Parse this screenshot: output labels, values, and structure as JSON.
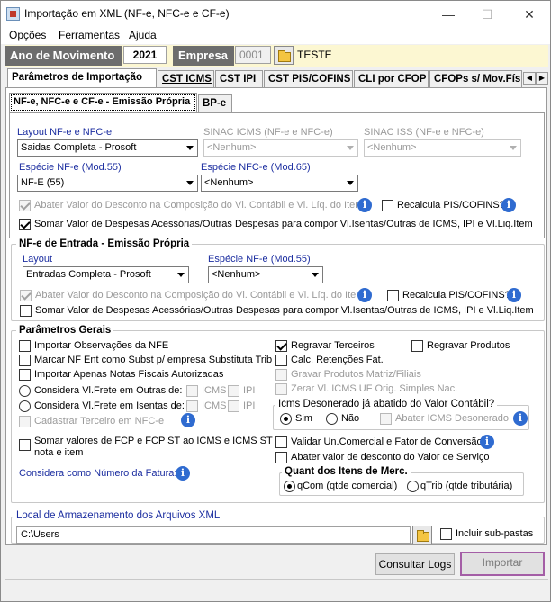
{
  "window": {
    "title": "Importação em XML (NF-e, NFC-e e CF-e)",
    "controls": {
      "minimize": "—",
      "maximize": "☐",
      "close": "✕"
    }
  },
  "menu": [
    "Opções",
    "Ferramentas",
    "Ajuda"
  ],
  "header": {
    "ano_label": "Ano de Movimento",
    "ano_value": "2021",
    "empresa_label": "Empresa",
    "empresa_code": "0001",
    "empresa_name": "TESTE"
  },
  "tabs": [
    "Parâmetros de Importação",
    "CST ICMS",
    "CST IPI",
    "CST PIS/COFINS",
    "CLI por CFOP",
    "CFOPs s/ Mov.Fís"
  ],
  "subtabs": [
    "NF-e, NFC-e e CF-e - Emissão Própria",
    "BP-e"
  ],
  "emissao": {
    "layout_label": "Layout NF-e e NFC-e",
    "layout_value": "Saidas Completa - Prosoft",
    "sinac_icms_label": "SINAC ICMS (NF-e e NFC-e)",
    "sinac_icms_value": "<Nenhum>",
    "sinac_iss_label": "SINAC ISS (NF-e e NFC-e)",
    "sinac_iss_value": "<Nenhum>",
    "especie_nfe_label": "Espécie NF-e (Mod.55)",
    "especie_nfe_value": "NF-E (55)",
    "especie_nfce_label": "Espécie NFC-e (Mod.65)",
    "especie_nfce_value": "<Nenhum>",
    "abater_desconto": "Abater Valor do Desconto na Composição do Vl. Contábil e Vl. Líq. do Item",
    "recalcula": "Recalcula PIS/COFINS?",
    "somar_despesas": "Somar Valor de Despesas Acessórias/Outras Despesas para compor Vl.Isentas/Outras de ICMS, IPI e Vl.Liq.Item"
  },
  "entrada": {
    "title": "NF-e de Entrada - Emissão Própria",
    "layout_label": "Layout",
    "layout_value": "Entradas Completa - Prosoft",
    "especie_label": "Espécie NF-e (Mod.55)",
    "especie_value": "<Nenhum>",
    "abater_desconto": "Abater Valor do Desconto na Composição do Vl. Contábil e Vl. Líq. do Item",
    "recalcula": "Recalcula PIS/COFINS?",
    "somar_despesas": "Somar Valor de Despesas Acessórias/Outras Despesas para compor Vl.Isentas/Outras de ICMS, IPI e Vl.Liq.Item"
  },
  "gerais": {
    "title": "Parâmetros Gerais",
    "importar_obs": "Importar Observações da NFE",
    "marcar_nf": "Marcar NF Ent como Subst p/ empresa Substituta Trib",
    "importar_autorizadas": "Importar Apenas Notas Fiscais Autorizadas",
    "frete_outras": "Considera Vl.Frete em Outras de:",
    "frete_isentas": "Considera Vl.Frete em Isentas de:",
    "icms": "ICMS",
    "ipi": "IPI",
    "cadastrar_terceiro": "Cadastrar Terceiro em NFC-e",
    "somar_fcp": "Somar valores de FCP e FCP ST ao ICMS e ICMS ST nota e item",
    "numero_fatura": "Considera como Número da Fatura:",
    "regravar_terceiros": "Regravar Terceiros",
    "regravar_produtos": "Regravar Produtos",
    "calc_retencoes": "Calc. Retenções Fat.",
    "gravar_produtos": "Gravar Produtos Matriz/Filiais",
    "zerar_icms": "Zerar Vl. ICMS UF Orig. Simples Nac.",
    "icms_deson_title": "Icms Desonerado já abatido do Valor Contábil?",
    "sim": "Sim",
    "nao": "Não",
    "abater_icms_deson": "Abater ICMS Desonerado",
    "validar_un": "Validar Un.Comercial e Fator de Conversão",
    "abater_desc_servico": "Abater valor de desconto do Valor de Serviço",
    "quant_title": "Quant dos Itens de Merc.",
    "qcom": "qCom (qtde comercial)",
    "qtrib": "qTrib (qtde tributária)"
  },
  "local": {
    "title": "Local de Armazenamento dos Arquivos XML",
    "path": "C:\\Users",
    "incluir_sub": "Incluir sub-pastas"
  },
  "buttons": {
    "consultar_logs": "Consultar Logs",
    "importar": "Importar"
  },
  "colors": {
    "accent_label": "#1c2ea0",
    "header_band": "#fcf7d2",
    "importar_border": "#a45ea6"
  }
}
